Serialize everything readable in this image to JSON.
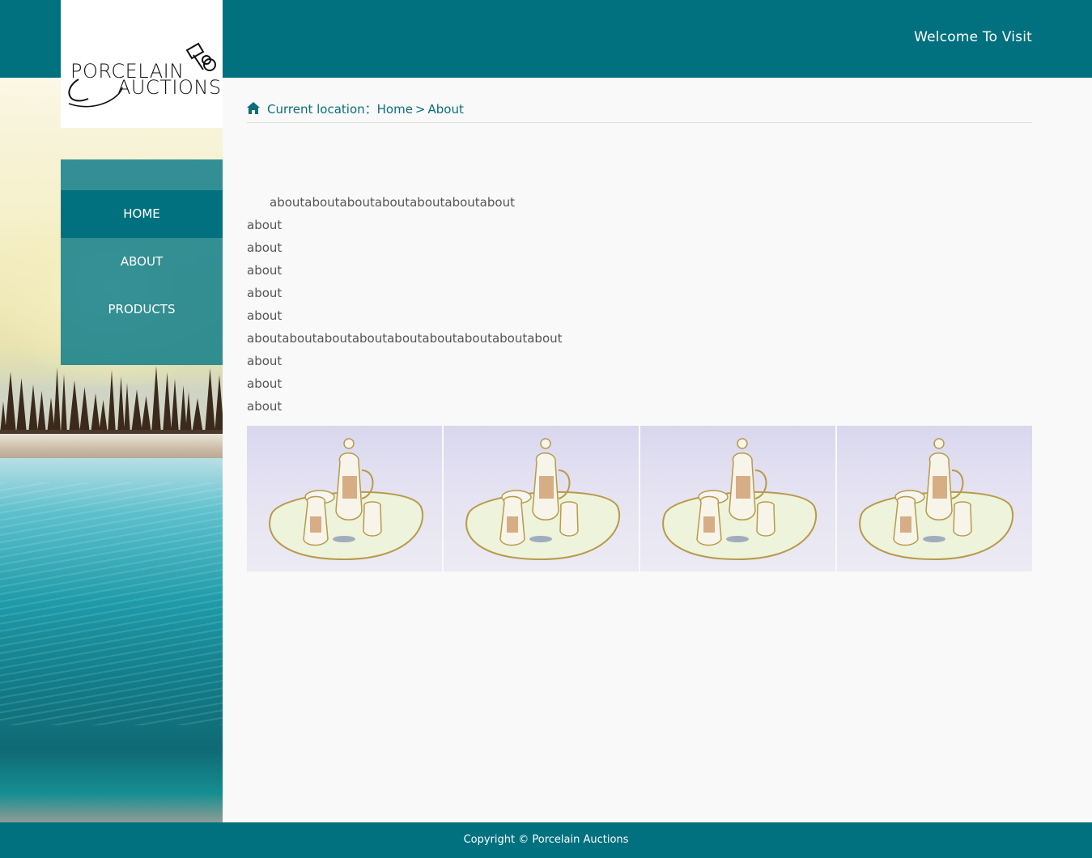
{
  "header": {
    "welcome": "Welcome To Visit"
  },
  "logo": {
    "line1": "PORCELAIN",
    "line2": "AUCTIONS"
  },
  "nav": {
    "items": [
      {
        "label": "HOME",
        "active": true
      },
      {
        "label": "ABOUT",
        "active": false
      },
      {
        "label": "PRODUCTS",
        "active": false
      }
    ]
  },
  "breadcrumb": {
    "icon": "home-icon",
    "prefix": "Current location：",
    "home": "Home",
    "separator": ">",
    "current": "About"
  },
  "article": {
    "lines": [
      "aboutaboutaboutaboutaboutaboutabout",
      "about",
      "about",
      "about",
      "about",
      "about",
      "aboutaboutaboutaboutaboutaboutaboutaboutabout",
      "about",
      "about",
      "about"
    ]
  },
  "gallery": {
    "count": 4
  },
  "footer": {
    "copyright": "Copyright © Porcelain Auctions"
  },
  "colors": {
    "brand": "#01717f",
    "nav_bg": "#117e8a",
    "text": "#555555",
    "link": "#0b6e7b"
  }
}
